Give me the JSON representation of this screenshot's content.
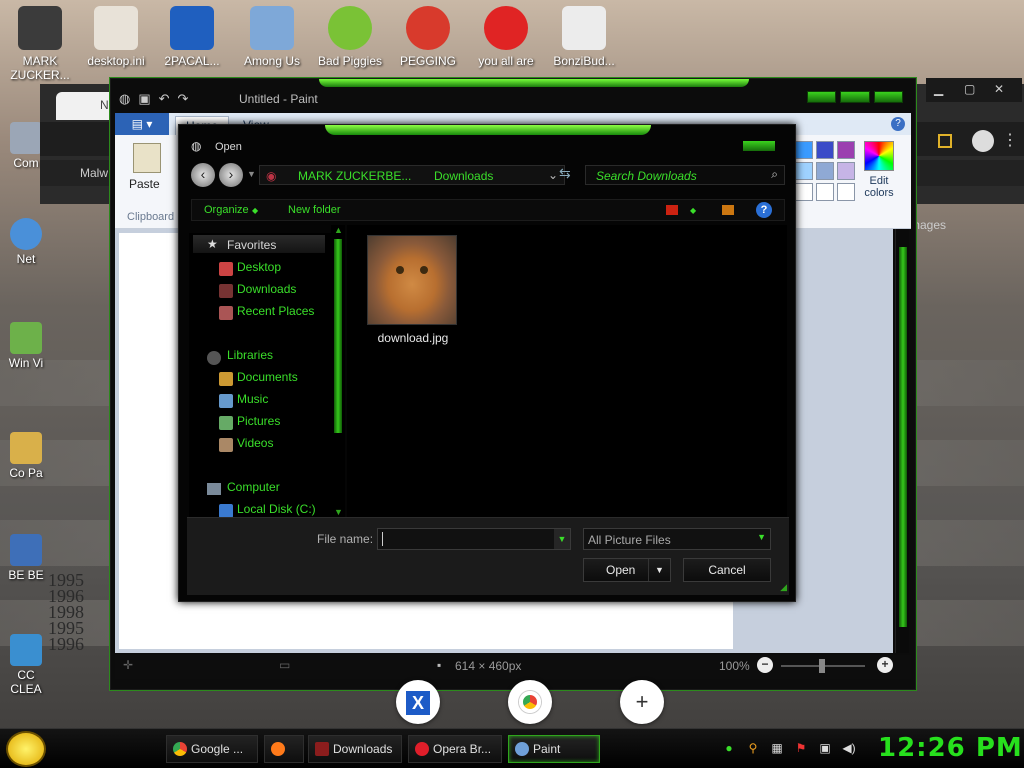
{
  "desktop": {
    "top_icons": [
      {
        "label": "MARK ZUCKER...",
        "color": "#3b3b3b"
      },
      {
        "label": "desktop.ini",
        "color": "#e8e2d8"
      },
      {
        "label": "2PACAL...",
        "color": "#1f5fbf"
      },
      {
        "label": "Among Us",
        "color": "#7ea8d8"
      },
      {
        "label": "Bad Piggies",
        "color": "#7ac236"
      },
      {
        "label": "PEGGING",
        "color": "#d83a2c"
      },
      {
        "label": "you all are",
        "color": "#e02424"
      },
      {
        "label": "BonziBud...",
        "color": "#ececec"
      }
    ],
    "side_icons": [
      {
        "label": "Com",
        "color": "#9ba6b6"
      },
      {
        "label": "Net",
        "color": "#4a90d9"
      },
      {
        "label": "Win Vi",
        "color": "#6db14a"
      },
      {
        "label": "Co Pa",
        "color": "#d9b04a"
      },
      {
        "label": "BE BE",
        "color": "#3e6fb8"
      },
      {
        "label": "CC CLEA",
        "color": "#3a8fd0"
      }
    ],
    "years_overlay": [
      "1995",
      "1996",
      "1998",
      "1995",
      "1996"
    ]
  },
  "browser_behind": {
    "tab_label": "New",
    "bookmark_label": "Malw",
    "right_text": "mages"
  },
  "paint": {
    "title": "Untitled - Paint",
    "tabs": [
      "Home",
      "View"
    ],
    "paste_label": "Paste",
    "clipboard_group": "Clipboard",
    "edit_colors_label": "Edit colors",
    "swatches": [
      "#3b9bff",
      "#3a4cc8",
      "#9b3fb0",
      "#9fd2ff",
      "#8fa9d4",
      "#c6b4e6",
      "#ffffff",
      "#ffffff",
      "#ffffff"
    ],
    "canvas_size": "614 × 460px",
    "zoom": "100%",
    "help": "?"
  },
  "open_dialog": {
    "title": "Open",
    "address": {
      "crumb1": "MARK ZUCKERBE...",
      "crumb2": "Downloads"
    },
    "search_placeholder": "Search Downloads",
    "toolbar": {
      "organize": "Organize",
      "new_folder": "New folder"
    },
    "nav": {
      "favorites": "Favorites",
      "favorites_items": [
        "Desktop",
        "Downloads",
        "Recent Places"
      ],
      "libraries": "Libraries",
      "library_items": [
        "Documents",
        "Music",
        "Pictures",
        "Videos"
      ],
      "computer": "Computer",
      "computer_items": [
        "Local Disk (C:)"
      ]
    },
    "files": [
      {
        "name": "download.jpg"
      }
    ],
    "file_name_label": "File name:",
    "file_name_value": "",
    "filter": "All Picture Files",
    "open_button": "Open",
    "cancel_button": "Cancel"
  },
  "taskbar": {
    "items": [
      {
        "label": "Google ...",
        "color": "#e94335"
      },
      {
        "label": "",
        "color": "#ff7a1a"
      },
      {
        "label": "Downloads",
        "color": "#8b1d1d"
      },
      {
        "label": "Opera Br...",
        "color": "#e01e2a"
      },
      {
        "label": "Paint",
        "color": "#6f9fd9"
      }
    ],
    "clock": "12:26 PM"
  },
  "accent": "#27e01d"
}
